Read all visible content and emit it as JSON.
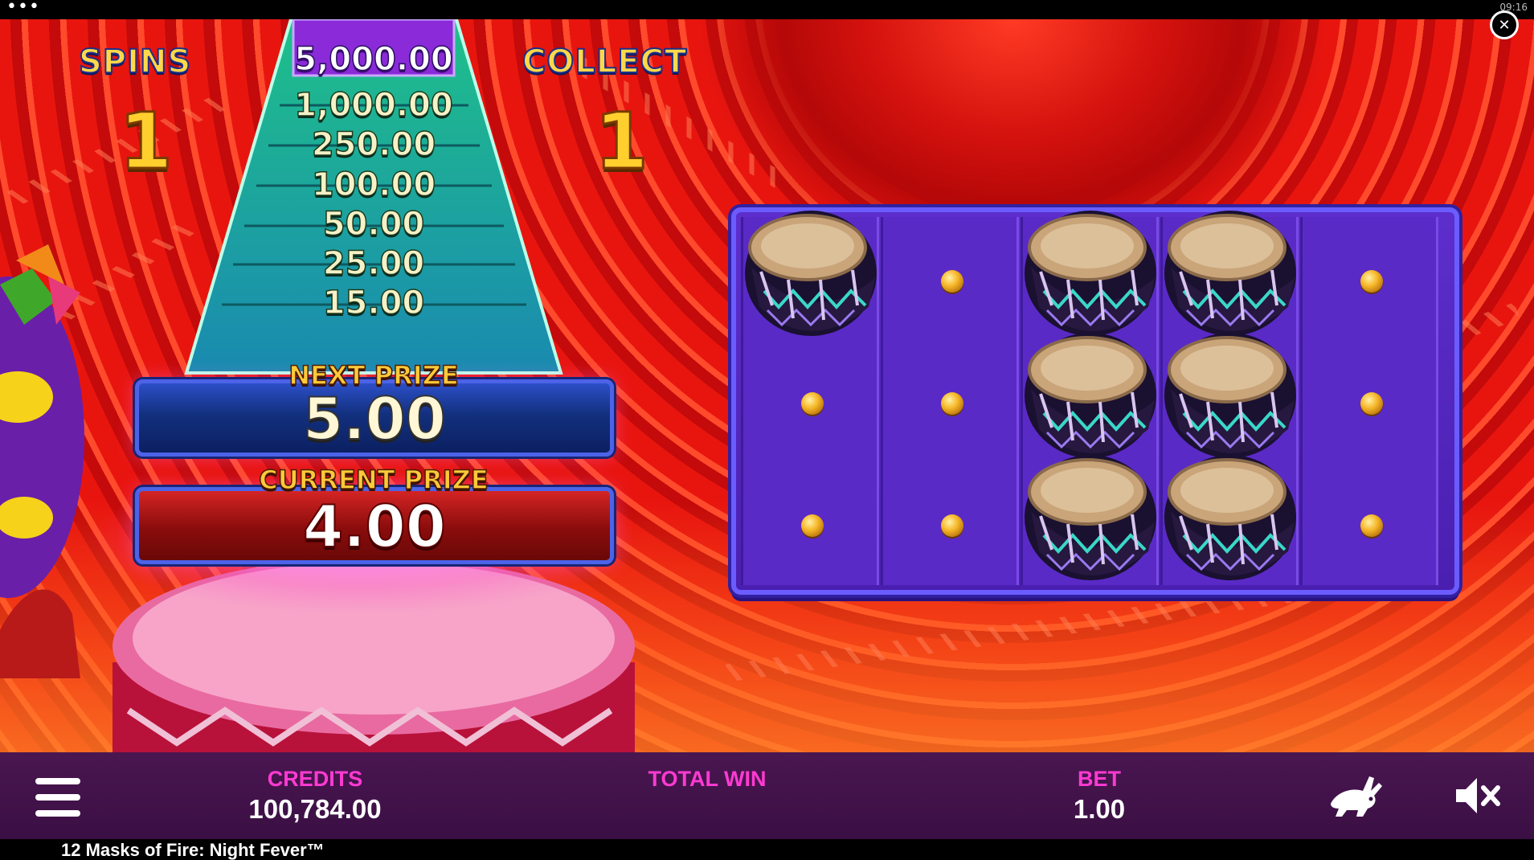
{
  "game": {
    "title": "12 Masks of Fire: Night Fever™",
    "clock": "09:16"
  },
  "counters": {
    "spins_label": "SPINS",
    "spins_value": "1",
    "collect_label": "COLLECT",
    "collect_value": "1"
  },
  "prize_ladder": [
    "5,000.00",
    "1,000.00",
    "250.00",
    "100.00",
    "50.00",
    "25.00",
    "15.00"
  ],
  "next_prize": {
    "label": "NEXT PRIZE",
    "value": "5.00"
  },
  "current_prize": {
    "label": "CURRENT PRIZE",
    "value": "4.00"
  },
  "reels": [
    [
      "drum",
      "coin",
      "coin"
    ],
    [
      "coin",
      "coin",
      "coin"
    ],
    [
      "drum",
      "drum",
      "drum"
    ],
    [
      "drum",
      "drum",
      "drum"
    ],
    [
      "coin",
      "coin",
      "coin"
    ]
  ],
  "hud": {
    "credits_label": "CREDITS",
    "credits_value": "100,784.00",
    "total_win_label": "TOTAL WIN",
    "total_win_value": "",
    "bet_label": "BET",
    "bet_value": "1.00"
  },
  "icons": {
    "menu": "hamburger-icon",
    "turbo": "rabbit-icon",
    "sound": "speaker-muted-icon",
    "close": "close-icon",
    "options": "dots-icon"
  },
  "colors": {
    "hud_label": "#ff3ad2",
    "grid": "#5a2ac6",
    "background": "#d10f0b"
  }
}
